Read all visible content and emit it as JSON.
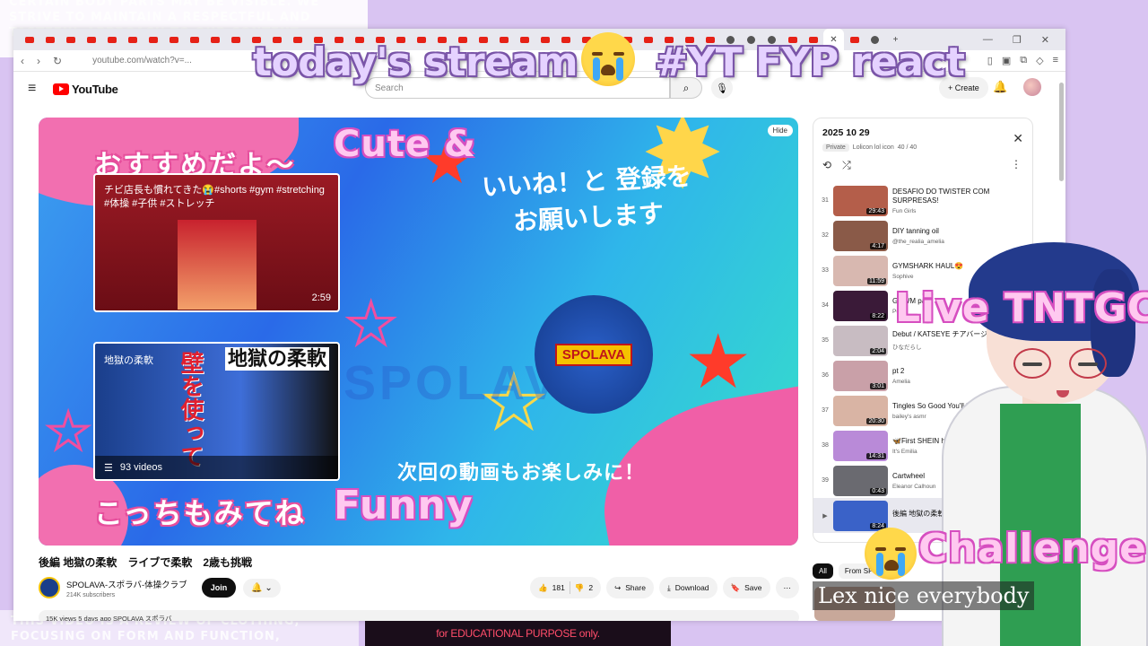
{
  "backdrop": {
    "top_text": "CERTAIN BODY PARTS MAY BE VISIBLE. WE STRIVE TO MAINTAIN A RESPECTFUL AND TASTEFUL APPROACH TO OUR CONTENT",
    "bottom_text": "THIS VIDEO IS A REVIEW OF CLOTHING, FOCUSING ON FORM AND FUNCTION,"
  },
  "overlays": {
    "stream_title": "today's stream",
    "stream_title_suffix": "#YT FYP react",
    "cute": "Cute &",
    "funny": "Funny",
    "live": "Live TNTGC",
    "challenge": "Challenge",
    "chat_message": "Lex nice everybody",
    "edu_disclaimer": "for EDUCATIONAL PURPOSE only."
  },
  "browser": {
    "url": "youtube.com/watch?v=...",
    "window_controls": [
      "—",
      "❐",
      "✕"
    ]
  },
  "youtube": {
    "logo_text": "YouTube",
    "search_placeholder": "Search",
    "create_label": "+ Create"
  },
  "player": {
    "hide_label": "Hide",
    "jp_top": "おすすめだよ～",
    "jp_bottom": "こっちもみてね",
    "jp_right": "いいね！と 登録を お願いします",
    "jp_next": "次回の動画もお楽しみに！",
    "logo_badge": "SPOLAVA",
    "watermark": "SPOLAVA",
    "thumb1_title": "チビ店長も慣れてきた😭#shorts #gym #stretching #体操 #子供 #ストレッチ",
    "thumb1_duration": "2:59",
    "thumb2_label": "地獄の柔軟",
    "thumb2_big": "壁を使って",
    "thumb2_big2": "地獄の柔軟",
    "thumb2_videos": "93 videos"
  },
  "video": {
    "title": "後編 地獄の柔軟　ライブで柔軟　2歳も挑戦",
    "channel_name": "SPOLAVA-スポラバ-体操クラブ",
    "subscribers": "214K subscribers",
    "join_label": "Join",
    "likes": "181",
    "dislikes": "2",
    "share_label": "Share",
    "download_label": "Download",
    "save_label": "Save",
    "description_preview": "15K views  5 days ago  SPOLAVA スポラバ"
  },
  "playlist": {
    "title": "2025 10 29",
    "privacy": "Private",
    "owner": "Lolicon lol icon",
    "position": "40 / 40",
    "items": [
      {
        "index": "31",
        "title": "DESAFIO DO TWISTER COM SURPRESAS!",
        "channel": "Fun Girls",
        "duration": "29:43",
        "color": "#b45e4a"
      },
      {
        "index": "32",
        "title": "DIY tanning oil",
        "channel": "@the_realia_amelia",
        "duration": "4:17",
        "color": "#8a5a48"
      },
      {
        "index": "33",
        "title": "GYMSHARK HAUL😍",
        "channel": "Sophive",
        "duration": "11:59",
        "color": "#d8b8b0"
      },
      {
        "index": "34",
        "title": "GRWM pa",
        "channel": "Pu",
        "duration": "8:22",
        "color": "#3a1a38"
      },
      {
        "index": "35",
        "title": "Debut / KATSEYE チアバージョン",
        "channel": "ひなだらし",
        "duration": "2:04",
        "color": "#c8bcc2"
      },
      {
        "index": "36",
        "title": "pt 2",
        "channel": "Amelia",
        "duration": "3:01",
        "color": "#c9a0a8"
      },
      {
        "index": "37",
        "title": "Tingles So Good You'll Replay It 🔁",
        "channel": "bailey's asmr",
        "duration": "20:30",
        "color": "#d9b4a4"
      },
      {
        "index": "38",
        "title": "🦋First SHEIN haul",
        "channel": "It's Emilia",
        "duration": "14:31",
        "color": "#b98ad8"
      },
      {
        "index": "39",
        "title": "Cartwheel",
        "channel": "Eleanor Calhoun",
        "duration": "0:43",
        "color": "#6a6a70"
      },
      {
        "index": "▶",
        "title": "後編 地獄の柔軟　2歳も挑戦",
        "channel": "",
        "duration": "8:24",
        "color": "#3a62c8"
      }
    ]
  },
  "chips": [
    "All",
    "From SPOLAVA"
  ]
}
